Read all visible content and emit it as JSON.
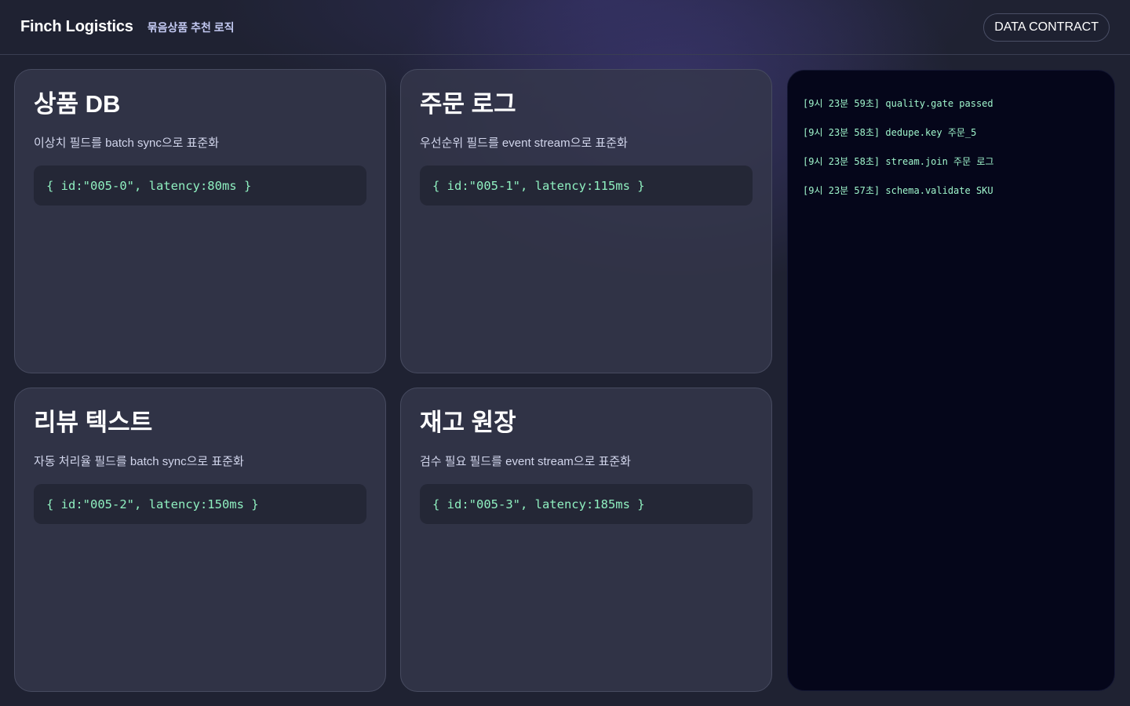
{
  "header": {
    "brand": "Finch Logistics",
    "subtitle": "묶음상품 추천 로직",
    "contract_button": "DATA CONTRACT"
  },
  "cards": [
    {
      "title": "상품 DB",
      "desc": "이상치 필드를 batch sync으로 표준화",
      "code": "{ id:\"005-0\", latency:80ms }"
    },
    {
      "title": "주문 로그",
      "desc": "우선순위 필드를 event stream으로 표준화",
      "code": "{ id:\"005-1\", latency:115ms }"
    },
    {
      "title": "리뷰 텍스트",
      "desc": "자동 처리율 필드를 batch sync으로 표준화",
      "code": "{ id:\"005-2\", latency:150ms }"
    },
    {
      "title": "재고 원장",
      "desc": "검수 필요 필드를 event stream으로 표준화",
      "code": "{ id:\"005-3\", latency:185ms }"
    }
  ],
  "log": {
    "lines": [
      "[9시 23분 59초] quality.gate passed",
      "[9시 23분 58초] dedupe.key 주문_5",
      "[9시 23분 58초] stream.join 주문 로그",
      "[9시 23분 57초] schema.validate SKU"
    ]
  },
  "colors": {
    "background": "#1f2232",
    "card": "#34374a",
    "code_text": "#8ff0c0",
    "subtitle": "#c3c9f2",
    "log_bg": "#05061a"
  }
}
